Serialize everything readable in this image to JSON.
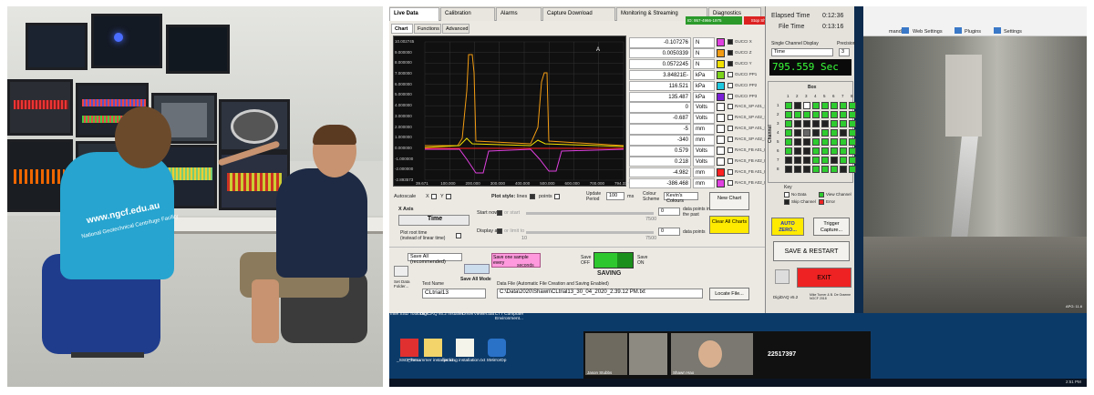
{
  "photo": {
    "shirt_text": "www.ngcf.edu.au",
    "shirt_subtext": "National Geotechnical Centrifuge Facility"
  },
  "app": {
    "tabs": [
      "Live Data",
      "Calibration",
      "Alarms",
      "Capture Download",
      "Monitoring & Streaming",
      "Diagnostics"
    ],
    "subtabs": [
      "Chart",
      "Functions",
      "Advanced"
    ],
    "stream_id": "ID: 957-4966-1975",
    "stop_share": "Stop Share",
    "chart": {
      "y_ticks": [
        "10.002745",
        "9.000000",
        "8.000000",
        "7.000000",
        "6.000000",
        "5.000000",
        "4.000000",
        "3.000000",
        "2.000000",
        "1.000000",
        "0.000000",
        "-1.000000",
        "-2.000000",
        "-2.893573"
      ],
      "x_ticks": [
        "39.671",
        "100.000",
        "200.000",
        "300.000",
        "400.000",
        "500.000",
        "600.000",
        "700.000",
        "794.337"
      ]
    },
    "channels": [
      {
        "value": "-0.107276",
        "unit": "N",
        "name": "GUCCI X",
        "color": "#e040e0",
        "checked": true
      },
      {
        "value": "0.0050339",
        "unit": "N",
        "name": "GUCCI Z",
        "color": "#f39c12",
        "checked": true
      },
      {
        "value": "0.0572245",
        "unit": "N",
        "name": "GUCCI Y",
        "color": "#f1e000",
        "checked": true
      },
      {
        "value": "3.84821E-",
        "unit": "kPa",
        "name": "GUCCI PP1",
        "color": "#7cd31a",
        "checked": false
      },
      {
        "value": "116.521",
        "unit": "kPa",
        "name": "GUCCI PP2",
        "color": "#1ec9e0",
        "checked": false
      },
      {
        "value": "135.487",
        "unit": "kPa",
        "name": "GUCCI PP3",
        "color": "#7b1fd6",
        "checked": false
      },
      {
        "value": "0",
        "unit": "Volts",
        "name": "RACS_SP A01_LOAD",
        "color": "#ffffff",
        "checked": false
      },
      {
        "value": "-0.687",
        "unit": "Volts",
        "name": "RACS_SP A02_LOAD",
        "color": "#ffffff",
        "checked": false
      },
      {
        "value": "-5",
        "unit": "mm",
        "name": "RACS_SP A01_DISP",
        "color": "#ffffff",
        "checked": false
      },
      {
        "value": "-340",
        "unit": "mm",
        "name": "RACS_SP A02_DISP",
        "color": "#ffffff",
        "checked": false
      },
      {
        "value": "0.579",
        "unit": "Volts",
        "name": "RACS_FB A01_LOAD",
        "color": "#ffffff",
        "checked": false
      },
      {
        "value": "0.218",
        "unit": "Volts",
        "name": "RACS_FB A02_LOAD",
        "color": "#ffffff",
        "checked": false
      },
      {
        "value": "-4.982",
        "unit": "mm",
        "name": "RACS_FB A01_DISP",
        "color": "#ff2020",
        "checked": false
      },
      {
        "value": "-386.468",
        "unit": "mm",
        "name": "RACS_FB A02_DISP",
        "color": "#e040e0",
        "checked": false
      }
    ],
    "controls": {
      "autoscale": "Autoscale",
      "x": "X",
      "y": "Y",
      "plot_style": "Plot style:",
      "lines": "lines",
      "points": "points",
      "update_period": "Update Period",
      "update_value": "100",
      "update_unit": "ms",
      "colour_scheme": "Colour Scheme",
      "colour_value": "Kevin's Colours",
      "new_chart": "New Chart",
      "x_axis": "X Axis",
      "x_axis_value": "Time",
      "plot_root": "Plot root time",
      "plot_root2": "(instead of linear time)",
      "start_now": "Start now",
      "or_start": "or start",
      "display_all": "Display all",
      "or_limit": "or limit to",
      "data_points_past": "data points in the past",
      "data_points": "data points",
      "n7500a": "7500",
      "n7500b": "7500",
      "n0": "0",
      "n0b": "0",
      "n10": "10",
      "clear_all": "Clear All Charts",
      "save_all": "Save All (recommended)",
      "save_one": "Save one sample every",
      "seconds": "seconds",
      "save_off": "Save OFF",
      "save_on": "Save ON",
      "saving": "SAVING",
      "save_all_mode": "Save All Mode",
      "set_data_folder": "Set Data Folder...",
      "test_name": "Test Name",
      "test_value": "CLtrial13",
      "data_file": "Data File (Automatic File Creation and Saving Enabled)",
      "data_file_value": "C:\\Data\\2020\\Shawn\\CLtrial13_30_04_2020_2.39.12 PM.txt",
      "locate_file": "Locate File..."
    },
    "right": {
      "elapsed_label": "Elapsed Time",
      "elapsed_value": "0:12:36",
      "file_label": "File Time",
      "file_value": "0:13:16",
      "single_display": "Single Channel Display",
      "precision": "Precision",
      "precision_value": "3",
      "channel_select": "Time",
      "big_value": "795.559 Sec",
      "box_label": "Box",
      "channel_label": "Channel",
      "col_nums": [
        "1",
        "2",
        "3",
        "4",
        "5",
        "6",
        "7",
        "8"
      ],
      "row_nums": [
        "1",
        "2",
        "3",
        "4",
        "5",
        "6",
        "7",
        "8"
      ],
      "key": "Key",
      "no_data": "No Data",
      "view_channel": "View Channel",
      "skip_channel": "Skip Channel",
      "error": "Error",
      "auto_zero": "AUTO ZERO...",
      "trigger": "Trigger Capture...",
      "save_restart": "SAVE & RESTART",
      "exit": "EXIT",
      "version": "DigiDAQ v5.2",
      "credits": "Mike Turner & B. De Graeme NGCF 2018"
    },
    "grid": [
      [
        "g",
        "d",
        "w",
        "g",
        "g",
        "g",
        "g",
        "g"
      ],
      [
        "g",
        "g",
        "g",
        "g",
        "g",
        "g",
        "g",
        "g"
      ],
      [
        "g",
        "d",
        "d",
        "d",
        "d",
        "g",
        "g",
        "g"
      ],
      [
        "g",
        "d",
        "k",
        "d",
        "g",
        "g",
        "d",
        "g"
      ],
      [
        "g",
        "d",
        "d",
        "g",
        "g",
        "g",
        "g",
        "g"
      ],
      [
        "g",
        "d",
        "d",
        "g",
        "g",
        "g",
        "g",
        "g"
      ],
      [
        "d",
        "d",
        "d",
        "g",
        "g",
        "d",
        "g",
        "g"
      ],
      [
        "d",
        "d",
        "d",
        "g",
        "g",
        "g",
        "d",
        "g"
      ]
    ]
  },
  "toolbar_video": {
    "items": [
      "mands",
      "Web Settings",
      "Plugins",
      "Settings"
    ],
    "overlay": "APG: 11.6"
  },
  "desktop": {
    "icons": [
      "Intel SSD Toolbox -...",
      "DigiDAQ v5.2 Installer",
      "DriverViewer.bat",
      "CT7 Computer Environment..."
    ],
    "icons2": [
      "_SSD_Too...",
      "PileHammer installer v1...",
      "jacking installation.txt",
      "SMirrorDp"
    ],
    "participants": [
      "Jason Stubbs",
      "Shawn Hao"
    ],
    "meeting_number": "22517397",
    "time": "2:51 PM"
  }
}
